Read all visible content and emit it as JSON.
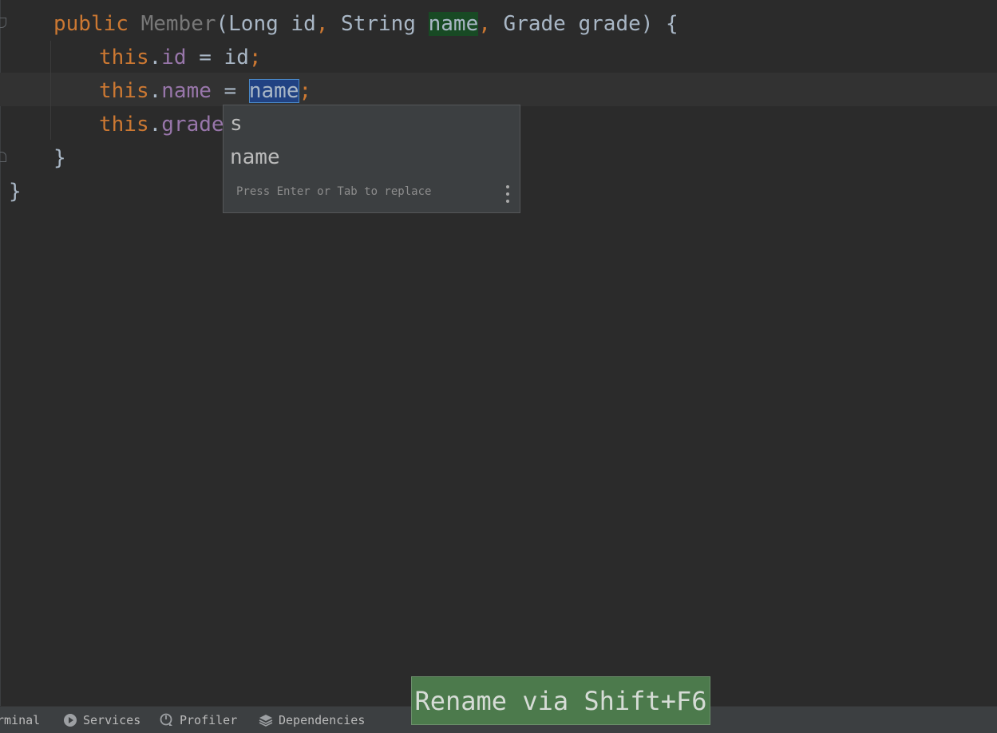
{
  "editor": {
    "lines": [
      {
        "tokens": [
          {
            "text": "public",
            "cls": "kw"
          },
          {
            "text": " ",
            "cls": "plain"
          },
          {
            "text": "Member",
            "cls": "ctor"
          },
          {
            "text": "(Long id",
            "cls": "plain"
          },
          {
            "text": ",",
            "cls": "punct"
          },
          {
            "text": " String ",
            "cls": "plain"
          },
          {
            "text": "name",
            "cls": "hl-green"
          },
          {
            "text": ",",
            "cls": "punct"
          },
          {
            "text": " Grade grade) {",
            "cls": "plain"
          }
        ]
      },
      {
        "tokens": [
          {
            "text": "this",
            "cls": "kw"
          },
          {
            "text": ".",
            "cls": "plain"
          },
          {
            "text": "id",
            "cls": "field"
          },
          {
            "text": " = id",
            "cls": "plain"
          },
          {
            "text": ";",
            "cls": "punct"
          }
        ]
      },
      {
        "tokens": [
          {
            "text": "this",
            "cls": "kw"
          },
          {
            "text": ".",
            "cls": "plain"
          },
          {
            "text": "name",
            "cls": "field"
          },
          {
            "text": " = ",
            "cls": "plain"
          },
          {
            "text": "name",
            "cls": "hl-select"
          },
          {
            "text": ";",
            "cls": "punct"
          }
        ]
      },
      {
        "tokens": [
          {
            "text": "this",
            "cls": "kw"
          },
          {
            "text": ".",
            "cls": "plain"
          },
          {
            "text": "grade",
            "cls": "field"
          },
          {
            "text": " =",
            "cls": "plain"
          }
        ]
      },
      {
        "tokens": [
          {
            "text": "}",
            "cls": "plain"
          }
        ]
      },
      {
        "tokens": [
          {
            "text": "}",
            "cls": "plain"
          }
        ]
      }
    ]
  },
  "completion_popup": {
    "items": [
      "s",
      "name"
    ],
    "hint": "Press Enter or Tab to replace",
    "menu_icon": "more-vertical-icon"
  },
  "tool_window_bar": {
    "tabs": [
      {
        "label": "rminal",
        "icon": "terminal-icon"
      },
      {
        "label": "Services",
        "icon": "services-icon"
      },
      {
        "label": "Profiler",
        "icon": "profiler-icon"
      },
      {
        "label": "Dependencies",
        "icon": "dependencies-icon"
      }
    ]
  },
  "rename_hint": {
    "text": "Rename via Shift+F6"
  },
  "colors": {
    "background": "#2b2b2b",
    "keyword": "#cc7832",
    "field": "#9876aa",
    "identifier": "#a9b7c6",
    "hint_background": "#4c7a4c"
  }
}
